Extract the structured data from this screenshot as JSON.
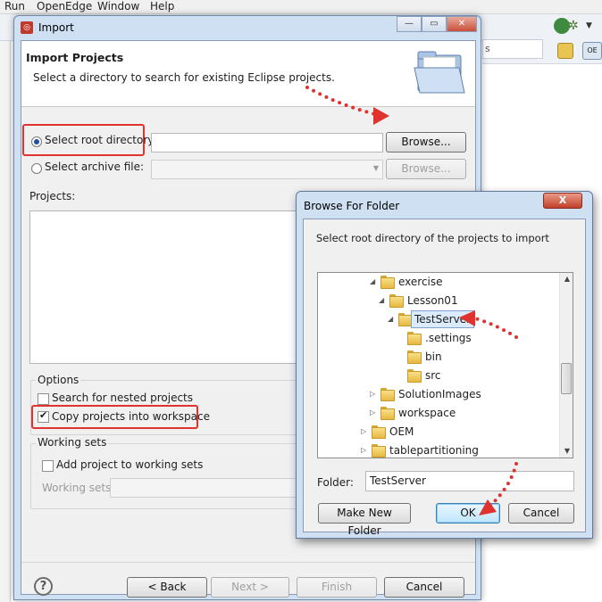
{
  "menubar": {
    "items": [
      "Run",
      "OpenEdge",
      "Window",
      "Help"
    ]
  },
  "background": {
    "right_field_text": "s"
  },
  "import_dialog": {
    "title": "Import",
    "heading": "Import Projects",
    "description": "Select a directory to search for existing Eclipse projects.",
    "root_directory": {
      "label": "Select root directory:",
      "selected": true,
      "value": "",
      "browse_label": "Browse..."
    },
    "archive_file": {
      "label": "Select archive file:",
      "selected": false,
      "value": "",
      "browse_label": "Browse..."
    },
    "projects_label": "Projects:",
    "options": {
      "title": "Options",
      "nested_projects": {
        "label": "Search for nested projects",
        "checked": false
      },
      "copy_projects": {
        "label": "Copy projects into workspace",
        "checked": true
      }
    },
    "working_sets": {
      "title": "Working sets",
      "add_project": {
        "label": "Add project to working sets",
        "checked": false
      },
      "sets_label": "Working sets:"
    },
    "footer": {
      "back": "< Back",
      "next": "Next >",
      "finish": "Finish",
      "cancel": "Cancel",
      "help": "?"
    }
  },
  "browse_dialog": {
    "title": "Browse For Folder",
    "close_label": "X",
    "instruction": "Select root directory of the projects to import",
    "tree": [
      {
        "label": "exercise",
        "depth": 0,
        "expanded": true
      },
      {
        "label": "Lesson01",
        "depth": 1,
        "expanded": true
      },
      {
        "label": "TestServer",
        "depth": 2,
        "expanded": true,
        "selected": true
      },
      {
        "label": ".settings",
        "depth": 3,
        "expanded": false
      },
      {
        "label": "bin",
        "depth": 3,
        "expanded": false
      },
      {
        "label": "src",
        "depth": 3,
        "expanded": false
      },
      {
        "label": "SolutionImages",
        "depth": 0,
        "expanded": false
      },
      {
        "label": "workspace",
        "depth": 0,
        "expanded": false
      },
      {
        "label": "OEM",
        "depth": -1,
        "expanded": false
      },
      {
        "label": "tablepartitioning",
        "depth": -1,
        "expanded": false
      }
    ],
    "folder_label": "Folder:",
    "folder_value": "TestServer",
    "make_new_folder": "Make New Folder",
    "ok": "OK",
    "cancel": "Cancel"
  },
  "colors": {
    "annotation_red": "#e0322e",
    "title_bar": "#cfe0f3",
    "dialog_face": "#f0f0f0"
  }
}
